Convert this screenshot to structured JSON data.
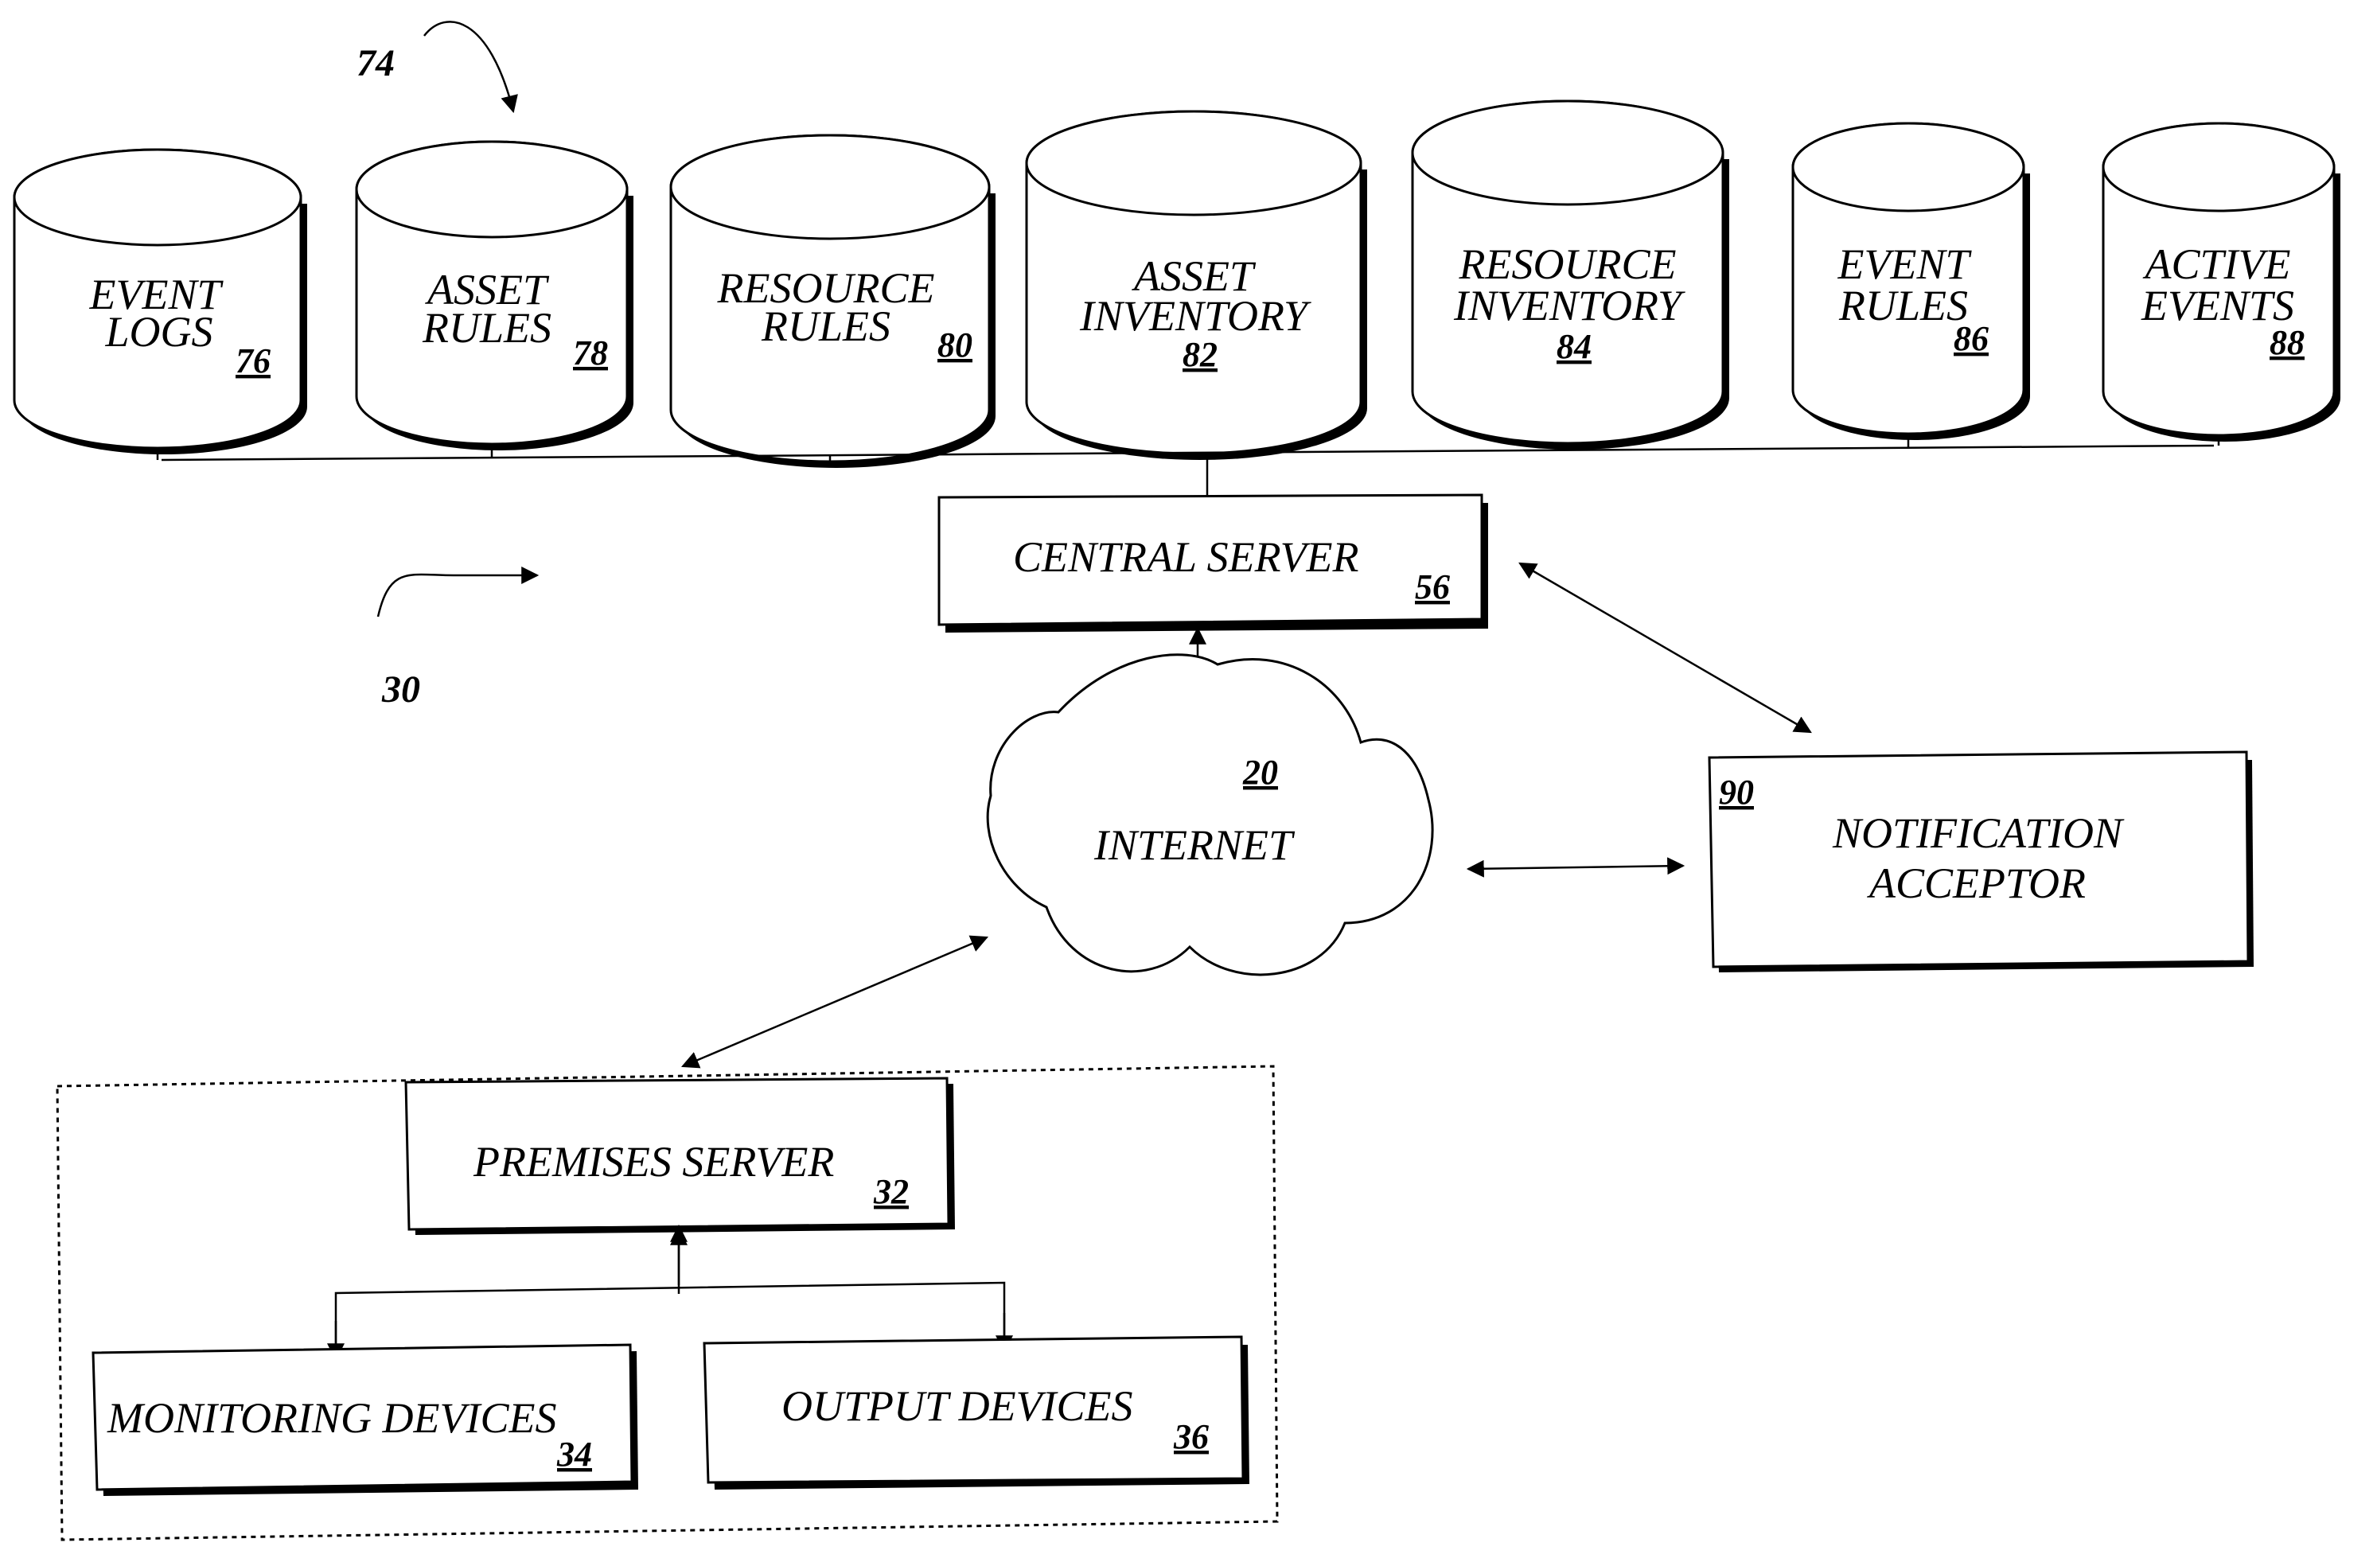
{
  "figure_refs": {
    "database_group": "74",
    "system": "30"
  },
  "databases": [
    {
      "lines": [
        "EVENT",
        "LOGS"
      ],
      "ref": "76"
    },
    {
      "lines": [
        "ASSET",
        "RULES"
      ],
      "ref": "78"
    },
    {
      "lines": [
        "RESOURCE",
        "RULES"
      ],
      "ref": "80"
    },
    {
      "lines": [
        "ASSET",
        "INVENTORY"
      ],
      "ref": "82"
    },
    {
      "lines": [
        "RESOURCE",
        "INVENTORY"
      ],
      "ref": "84"
    },
    {
      "lines": [
        "EVENT",
        "RULES"
      ],
      "ref": "86"
    },
    {
      "lines": [
        "ACTIVE",
        "EVENTS"
      ],
      "ref": "88"
    }
  ],
  "central_server": {
    "label": "CENTRAL SERVER",
    "ref": "56"
  },
  "internet": {
    "label": "INTERNET",
    "ref": "20"
  },
  "notification_acceptor": {
    "lines": [
      "NOTIFICATION",
      "ACCEPTOR"
    ],
    "ref": "90"
  },
  "premises": {
    "server": {
      "label": "PREMISES SERVER",
      "ref": "32"
    },
    "monitoring": {
      "label": "MONITORING DEVICES",
      "ref": "34"
    },
    "output": {
      "label": "OUTPUT DEVICES",
      "ref": "36"
    }
  }
}
